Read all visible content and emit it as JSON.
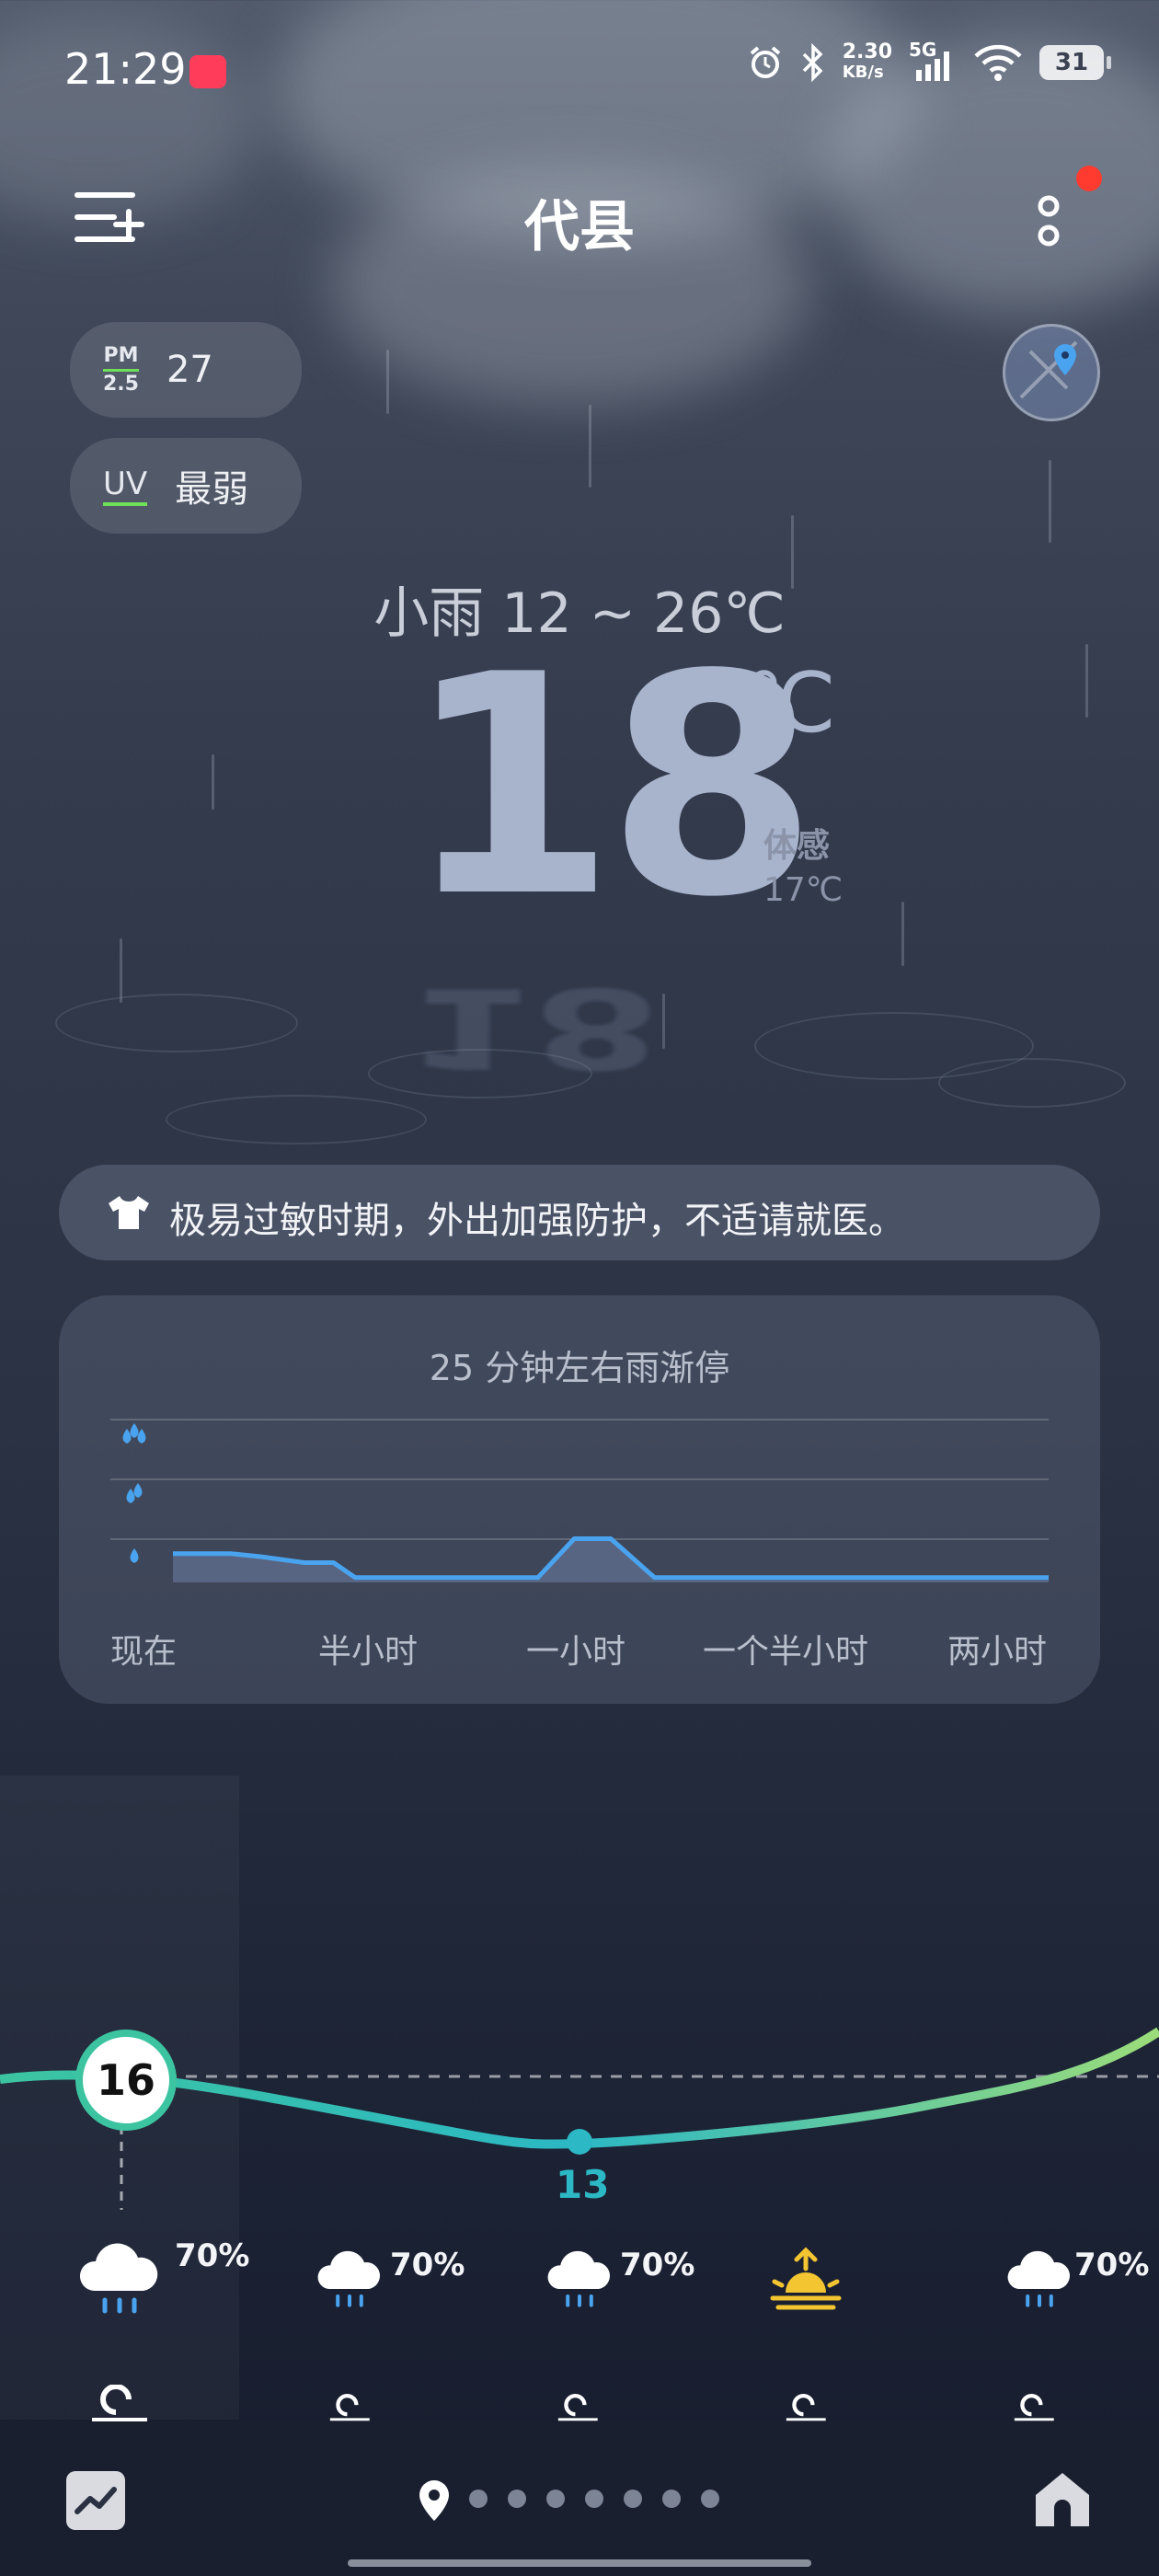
{
  "status_bar": {
    "time": "21:29",
    "net_speed_value": "2.30",
    "net_speed_unit": "KB/s",
    "network": "5G",
    "battery": "31"
  },
  "header": {
    "city": "代县"
  },
  "air": {
    "pm_label_top": "PM",
    "pm_label_bottom": "2.5",
    "pm_value": "27",
    "uv_label": "UV",
    "uv_value": "最弱"
  },
  "current": {
    "condition_range": "小雨  12 ~ 26℃",
    "temperature": "18",
    "unit": "℃",
    "feels_label": "体感",
    "feels_value": "17℃"
  },
  "advice": {
    "text": "极易过敏时期，外出加强防护，不适请就医。"
  },
  "precip_card": {
    "title": "25 分钟左右雨渐停",
    "x_labels": [
      "现在",
      "半小时",
      "一小时",
      "一个半小时",
      "两小时"
    ]
  },
  "chart_data": {
    "type": "area",
    "title": "25 分钟左右雨渐停",
    "categories": [
      "现在",
      "半小时",
      "一小时",
      "一个半小时",
      "两小时"
    ],
    "x_minutes": [
      0,
      8,
      12,
      18,
      22,
      25,
      40,
      50,
      55,
      60,
      66,
      80,
      120
    ],
    "series": [
      {
        "values": [
          0.45,
          0.45,
          0.4,
          0.3,
          0.3,
          0.05,
          0.05,
          0.05,
          0.7,
          0.7,
          0.05,
          0.05,
          0.05
        ]
      }
    ],
    "ylim": [
      0,
      3
    ],
    "y_levels": [
      "小雨",
      "中雨",
      "大雨"
    ]
  },
  "hourly": {
    "temp_now": "16",
    "temp_min": "13",
    "items": [
      {
        "pop": "70%",
        "icon": "rain-cloud-icon"
      },
      {
        "pop": "70%",
        "icon": "rain-cloud-icon"
      },
      {
        "pop": "70%",
        "icon": "rain-cloud-icon"
      },
      {
        "pop": "",
        "icon": "sunrise-icon"
      },
      {
        "pop": "70%",
        "icon": "rain-cloud-icon"
      }
    ]
  },
  "colors": {
    "accent_line": "#3cc4b4",
    "rain_blue": "#4aa3ee",
    "pm_green": "#6ee05a",
    "notification_red": "#ff3b30"
  }
}
